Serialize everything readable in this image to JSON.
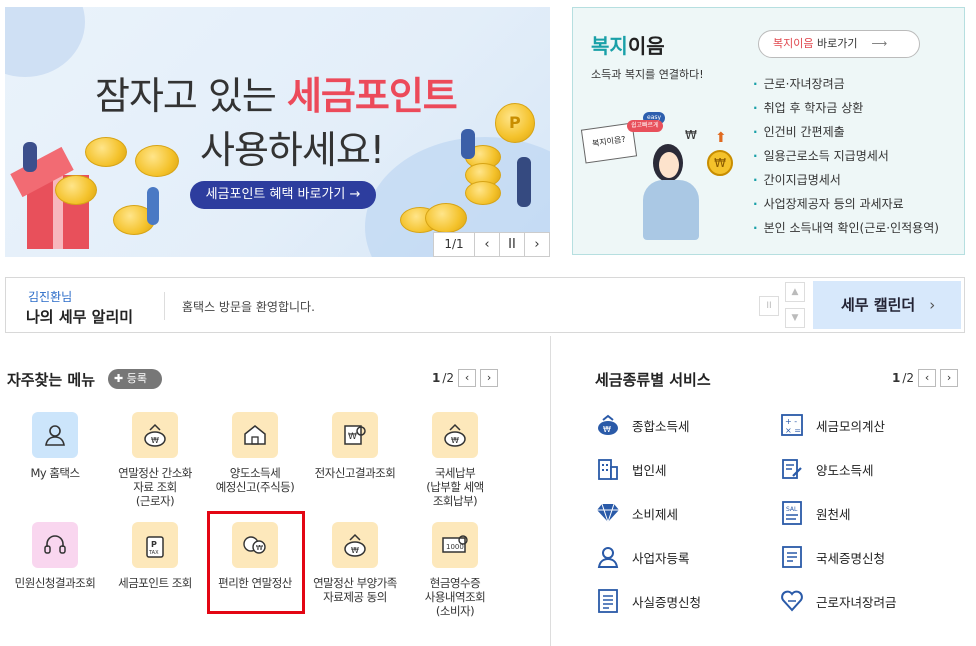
{
  "banner": {
    "line1_prefix": "잠자고 있는 ",
    "line1_highlight": "세금포인트",
    "line2": "사용하세요!",
    "cta": "세금포인트 혜택 바로가기 →",
    "page": "1/1",
    "prev": "‹",
    "pause": "II",
    "next": "›"
  },
  "welfare": {
    "title_brand": "복지",
    "title_rest": "이음",
    "subtitle": "소득과 복지를 연결하다!",
    "button_brand": "복지이음",
    "button_rest": " 바로가기",
    "items": [
      "근로·자녀장려금",
      "취업 후 학자금 상환",
      "인건비 간편제출",
      "일용근로소득 지급명세서",
      "간이지급명세서",
      "사업장제공자 등의 과세자료",
      "본인 소득내역 확인(근로·인적용역)"
    ],
    "illustration_texts": [
      "복지이음?",
      "easy",
      "쉽고빠르게"
    ]
  },
  "notice": {
    "user": "김진환님",
    "title": "나의 세무 알리미",
    "message": "홈택스 방문을 환영합니다.",
    "calendar": "세무 캘린더",
    "calendar_arrow": "›"
  },
  "frequent": {
    "title": "자주찾는 메뉴",
    "register": "✚ 등록",
    "page_current": "1",
    "page_total": "/2",
    "items": [
      {
        "label": "My 홈택스",
        "icon": "user-icon"
      },
      {
        "label": "연말정산 간소화\n자료 조회\n(근로자)",
        "icon": "money-bag-icon"
      },
      {
        "label": "양도소득세\n예정신고(주식등)",
        "icon": "house-icon"
      },
      {
        "label": "전자신고결과조회",
        "icon": "document-search-icon"
      },
      {
        "label": "국세납부\n(납부할 세액\n조회납부)",
        "icon": "money-bag-icon"
      },
      {
        "label": "민원신청결과조회",
        "icon": "headset-icon"
      },
      {
        "label": "세금포인트 조회",
        "icon": "tax-point-icon"
      },
      {
        "label": "편리한 연말정산",
        "icon": "smile-coin-icon"
      },
      {
        "label": "연말정산 부양가족\n자료제공 동의",
        "icon": "money-bag-icon"
      },
      {
        "label": "현금영수증\n사용내역조회\n(소비자)",
        "icon": "receipt-search-icon"
      }
    ]
  },
  "taxservices": {
    "title": "세금종류별 서비스",
    "page_current": "1",
    "page_total": "/2",
    "items": [
      {
        "label": "종합소득세",
        "icon": "income-tax-icon"
      },
      {
        "label": "세금모의계산",
        "icon": "calculator-icon"
      },
      {
        "label": "법인세",
        "icon": "building-icon"
      },
      {
        "label": "양도소득세",
        "icon": "transfer-document-icon"
      },
      {
        "label": "소비제세",
        "icon": "diamond-icon"
      },
      {
        "label": "원천세",
        "icon": "sal-document-icon"
      },
      {
        "label": "사업자등록",
        "icon": "person-icon"
      },
      {
        "label": "국세증명신청",
        "icon": "certificate-icon"
      },
      {
        "label": "사실증명신청",
        "icon": "document-icon"
      },
      {
        "label": "근로자녀장려금",
        "icon": "heart-hands-icon"
      }
    ]
  }
}
